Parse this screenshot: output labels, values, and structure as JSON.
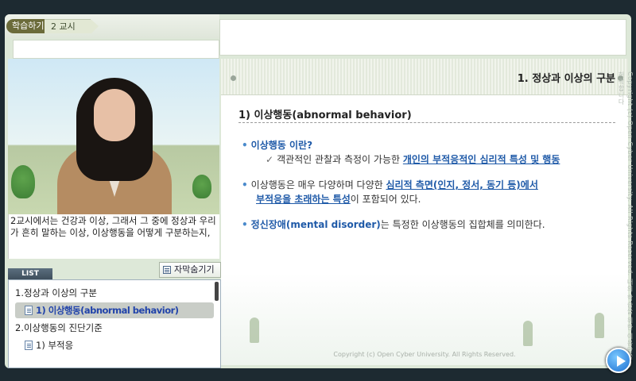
{
  "header": {
    "learn_tab": "학습하기",
    "period_tab": "2 교시"
  },
  "video": {
    "subtitle": "2교시에서는 건강과 이상, 그래서 그 중에 정상과 우리가 흔히 말하는 이상, 이상행동을 어떻게 구분하는지,",
    "hide_subtitle_label": "자막숨기기"
  },
  "list": {
    "tab_label": "LIST",
    "items": [
      {
        "label": "1.정상과 이상의 구분",
        "level": 1,
        "active": false
      },
      {
        "label": "1) 이상행동(abnormal behavior)",
        "level": 2,
        "active": true
      },
      {
        "label": "2.이상행동의 진단기준",
        "level": 1,
        "active": false
      },
      {
        "label": "1) 부적응",
        "level": 2,
        "active": false
      }
    ]
  },
  "slide": {
    "title": "1. 정상과 이상의 구분",
    "section": "1) 이상행동(abnormal behavior)",
    "bullets": [
      {
        "heading": "이상행동 이란?",
        "detail_prefix": "객관적인 관찰과 측정이 가능한 ",
        "detail_highlight": "개인의 부적응적인 심리적 특성 및 행동"
      },
      {
        "text_prefix": "이상행동은 매우 다양하며 다양한 ",
        "highlight_line1": "심리적 측면(인지, 정서, 동기 등)에서",
        "highlight_line2": "부적응을 초래하는 특성",
        "text_suffix": "이 포함되어 있다."
      },
      {
        "highlight": "정신장애(mental disorder)",
        "text_suffix": "는 특정한 이상행동의 집합체를 의미한다."
      }
    ],
    "copyright": "Copyright (c) Open Cyber University. All Rights Reserved.",
    "watermark": "Copyright (c) Open Cyber University. All Rights Reserved. 내의 학습을 위한 이용만을 허락합니다"
  },
  "colors": {
    "highlight_blue": "#1f5aa8",
    "learn_tab_bg": "#6b6b3a",
    "active_item_text": "#2244aa"
  }
}
